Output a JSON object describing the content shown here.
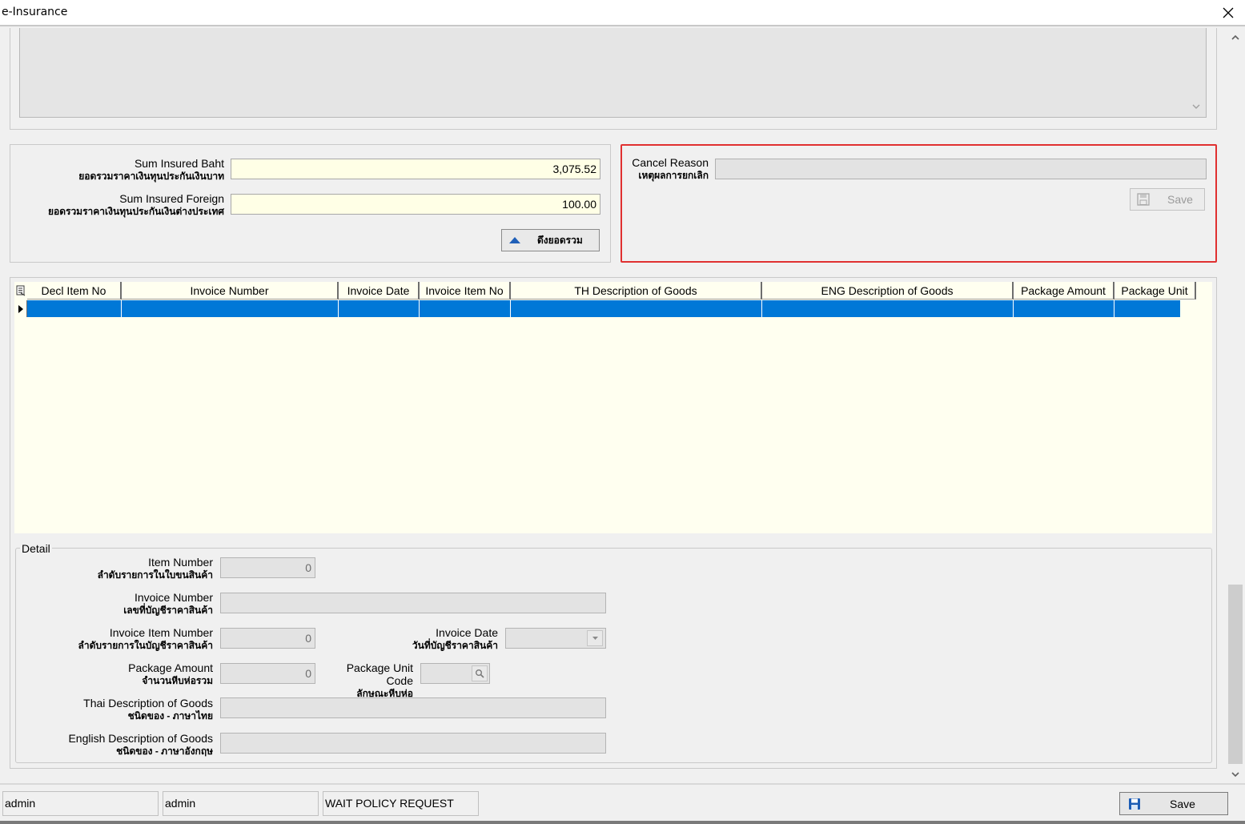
{
  "window": {
    "title": "e-Insurance",
    "close_icon": "close-icon"
  },
  "sum_panel": {
    "sum_baht_label_en": "Sum Insured Baht",
    "sum_baht_label_th": "ยอดรวมราคาเงินทุนประกันเงินบาท",
    "sum_baht_value": "3,075.52",
    "sum_foreign_label_en": "Sum Insured Foreign",
    "sum_foreign_label_th": "ยอดรวมราคาเงินทุนประกันเงินต่างประเทศ",
    "sum_foreign_value": "100.00",
    "pull_total_label": "ดึงยอดรวม",
    "pull_total_icon": "triangle-up-icon"
  },
  "cancel_panel": {
    "label_en": "Cancel Reason",
    "label_th": "เหตุผลการยกเลิก",
    "value": "",
    "save_label": "Save",
    "save_icon": "floppy-disk-icon"
  },
  "grid": {
    "columns": [
      "Decl Item No",
      "Invoice Number",
      "Invoice Date",
      "Invoice Item No",
      "TH Description of Goods",
      "ENG Description of Goods",
      "Package Amount",
      "Package Unit"
    ],
    "selected_row": [
      "",
      "",
      "",
      "",
      "",
      "",
      "",
      ""
    ]
  },
  "detail": {
    "legend": "Detail",
    "item_number_en": "Item Number",
    "item_number_th": "ลำดับรายการในใบขนสินค้า",
    "item_number_value": "0",
    "invoice_number_en": "Invoice Number",
    "invoice_number_th": "เลขที่บัญชีราคาสินค้า",
    "invoice_number_value": "",
    "invoice_item_number_en": "Invoice Item Number",
    "invoice_item_number_th": "ลำดับรายการในบัญชีราคาสินค้า",
    "invoice_item_number_value": "0",
    "invoice_date_en": "Invoice Date",
    "invoice_date_th": "วันที่บัญชีราคาสินค้า",
    "invoice_date_value": "",
    "package_amount_en": "Package Amount",
    "package_amount_th": "จำนวนหีบห่อรวม",
    "package_amount_value": "0",
    "package_unit_code_en": "Package Unit Code",
    "package_unit_code_th": "ลักษณะหีบห่อ",
    "package_unit_code_value": "",
    "thai_desc_en": "Thai Description of Goods",
    "thai_desc_th": "ชนิดของ - ภาษาไทย",
    "thai_desc_value": "",
    "eng_desc_en": "English Description of Goods",
    "eng_desc_th": "ชนิดของ - ภาษาอังกฤษ",
    "eng_desc_value": ""
  },
  "status_bar": {
    "user1": "admin",
    "user2": "admin",
    "status": "WAIT POLICY REQUEST",
    "save_label": "Save",
    "save_icon": "floppy-disk-icon"
  }
}
